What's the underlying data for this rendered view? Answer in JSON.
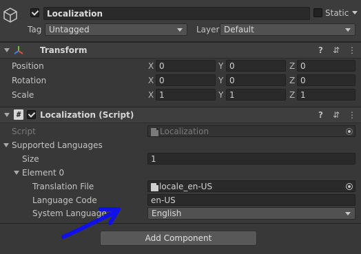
{
  "gameobject": {
    "name": "Localization",
    "active": true,
    "static_label": "Static",
    "tag_label": "Tag",
    "tag_value": "Untagged",
    "layer_label": "Layer",
    "layer_value": "Default"
  },
  "transform": {
    "title": "Transform",
    "rows": [
      {
        "label": "Position",
        "x": "0",
        "y": "0",
        "z": "0"
      },
      {
        "label": "Rotation",
        "x": "0",
        "y": "0",
        "z": "0"
      },
      {
        "label": "Scale",
        "x": "1",
        "y": "1",
        "z": "1"
      }
    ],
    "axis_x": "X",
    "axis_y": "Y",
    "axis_z": "Z"
  },
  "script_component": {
    "title": "Localization (Script)",
    "enabled": true,
    "script_label": "Script",
    "script_value": "Localization",
    "supported_languages_label": "Supported Languages",
    "size_label": "Size",
    "size_value": "1",
    "element_label": "Element 0",
    "translation_file_label": "Translation File",
    "translation_file_value": "locale_en-US",
    "language_code_label": "Language Code",
    "language_code_value": "en-US",
    "system_language_label": "System Language",
    "system_language_value": "English"
  },
  "add_component_label": "Add Component",
  "header_icons": {
    "help": "?",
    "presets": "⇵",
    "more": "⋮"
  },
  "colors": {
    "annotation_arrow": "#1010e8",
    "panel_bg": "#383838"
  }
}
